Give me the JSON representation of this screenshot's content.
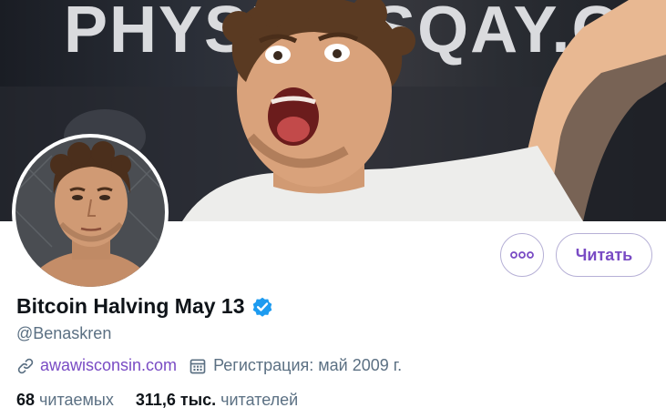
{
  "banner": {
    "text": "PHYSICOSQAY.COM",
    "icon": "banner-photo"
  },
  "profile": {
    "name": "Bitcoin Halving May 13",
    "handle": "@Benaskren",
    "verified_icon": "verified-badge-icon",
    "website": "awawisconsin.com",
    "joined": "Регистрация: май 2009 г."
  },
  "actions": {
    "more_icon": "more-dots-icon",
    "follow_label": "Читать"
  },
  "stats": {
    "following_count": "68",
    "following_label": "читаемых",
    "followers_count": "311,6 тыс.",
    "followers_label": "читателей"
  },
  "colors": {
    "accent": "#794bc4",
    "verified": "#1d9bf0",
    "secondary_text": "#5b7083",
    "primary_text": "#0f1419",
    "button_border": "#b6b0d6"
  }
}
